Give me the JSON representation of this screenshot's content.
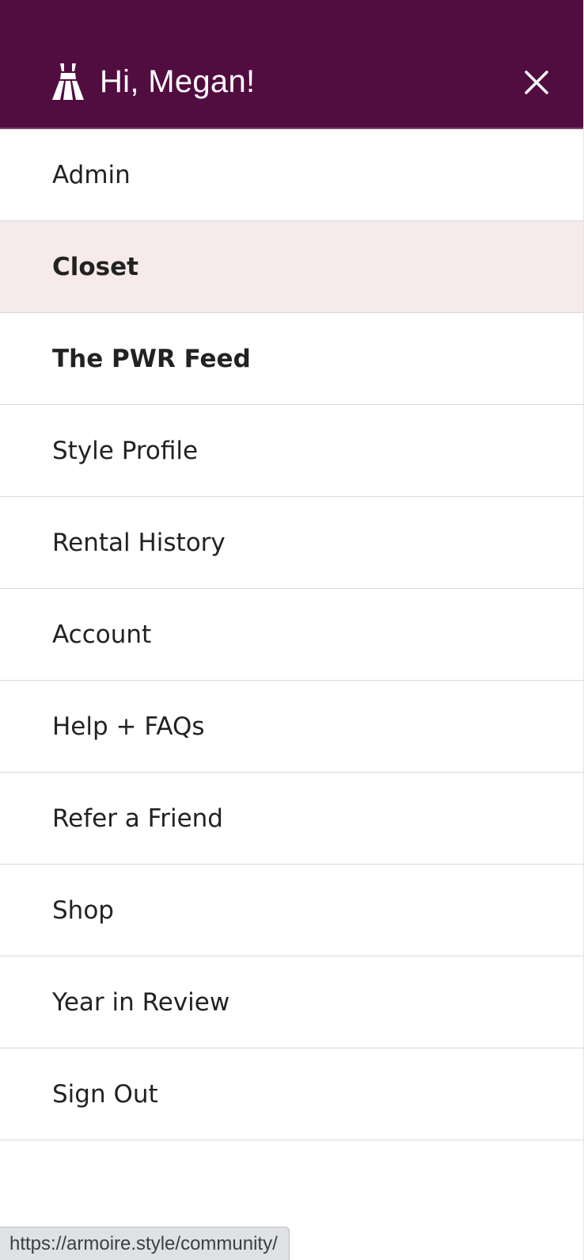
{
  "header": {
    "greeting": "Hi, Megan!",
    "brand_icon": "dress-icon",
    "close_icon": "close-icon",
    "background_color": "#520d40"
  },
  "menu": {
    "items": [
      {
        "id": "admin",
        "label": "Admin",
        "bold": false,
        "active": false
      },
      {
        "id": "closet",
        "label": "Closet",
        "bold": true,
        "active": true
      },
      {
        "id": "pwr-feed",
        "label": "The PWR Feed",
        "bold": true,
        "active": false
      },
      {
        "id": "style-profile",
        "label": "Style Profile",
        "bold": false,
        "active": false
      },
      {
        "id": "rental-history",
        "label": "Rental History",
        "bold": false,
        "active": false
      },
      {
        "id": "account",
        "label": "Account",
        "bold": false,
        "active": false
      },
      {
        "id": "help-faqs",
        "label": "Help + FAQs",
        "bold": false,
        "active": false
      },
      {
        "id": "refer-a-friend",
        "label": "Refer a Friend",
        "bold": false,
        "active": false
      },
      {
        "id": "shop",
        "label": "Shop",
        "bold": false,
        "active": false
      },
      {
        "id": "year-in-review",
        "label": "Year in Review",
        "bold": false,
        "active": false
      },
      {
        "id": "sign-out",
        "label": "Sign Out",
        "bold": false,
        "active": false
      }
    ],
    "active_background": "#f6eaea"
  },
  "status_bar": {
    "url": "https://armoire.style/community/"
  }
}
